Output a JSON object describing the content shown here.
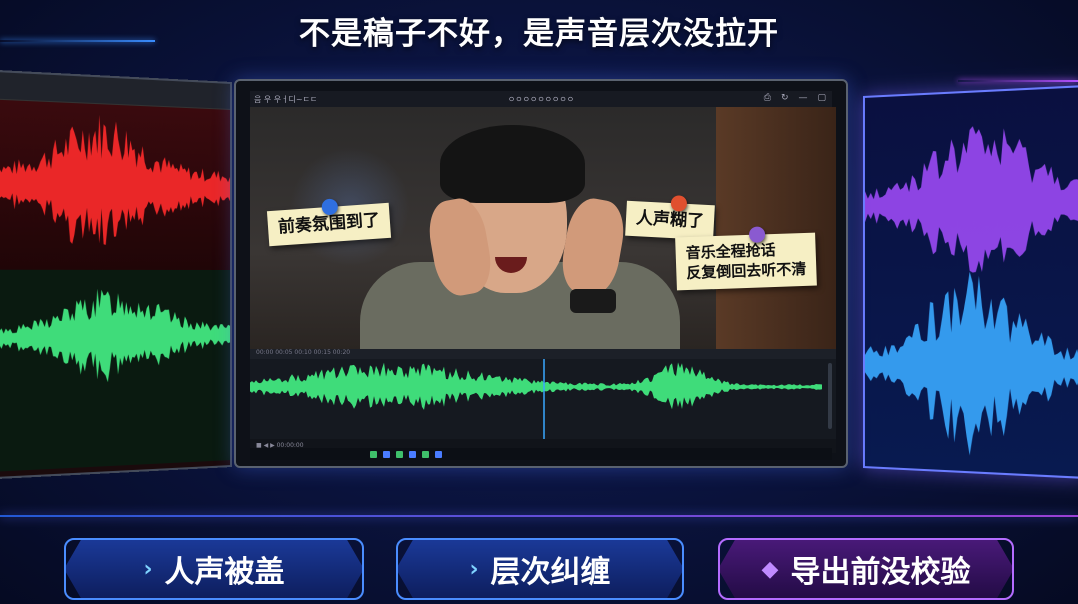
{
  "headline": "不是稿子不好，是声音层次没拉开",
  "editor": {
    "title_left": "음 우 우ㅓ디~ㄷㄷ",
    "title_center": "ㅇㅇㅇㅇㅇㅇㅇㅇㅇ",
    "ruler_text": "00:00   00:05   00:10   00:15   00:20",
    "status_text": "■ ◀ ▶  00:00:00",
    "window_buttons": [
      "⎙",
      "↻",
      "—",
      "▢"
    ]
  },
  "notes": [
    {
      "text": "前奏氛围到了",
      "pin_color": "#2f6fe0"
    },
    {
      "text": "人声糊了",
      "pin_color": "#e0502f"
    },
    {
      "line1": "音乐全程抢话",
      "line2": "反复倒回去听不清",
      "pin_color": "#8a5ad0"
    }
  ],
  "buttons": [
    {
      "label": "人声被盖",
      "icon": "chevron-right-icon",
      "glyph": "›"
    },
    {
      "label": "层次纠缠",
      "icon": "chevron-right-icon",
      "glyph": "›"
    },
    {
      "label": "导出前没校验",
      "icon": "diamond-icon",
      "glyph": "◆"
    }
  ],
  "colors": {
    "accent_blue": "#4a8dff",
    "accent_purple": "#b46cff",
    "wave_green": "#3fdc7a",
    "wave_red": "#ff2b2b"
  }
}
